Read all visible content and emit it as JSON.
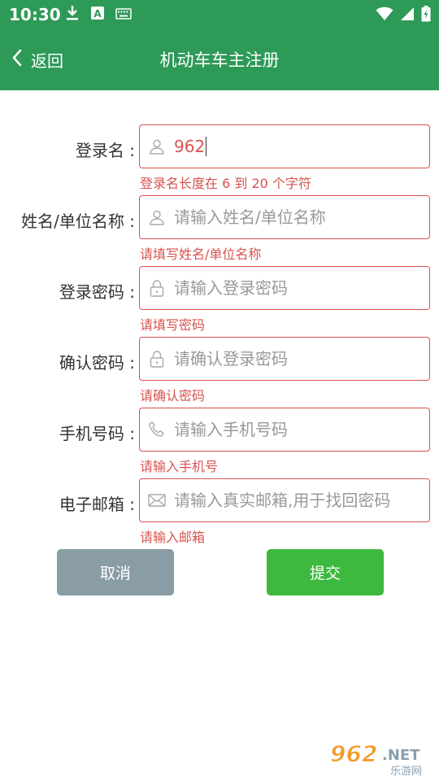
{
  "status": {
    "time": "10:30"
  },
  "header": {
    "back_label": "返回",
    "title": "机动车车主注册"
  },
  "form": {
    "rows": [
      {
        "label": "登录名 :",
        "value": "962",
        "placeholder": "",
        "error": "登录名长度在 6 到 20 个字符",
        "icon": "user-icon"
      },
      {
        "label": "姓名/单位名称 :",
        "value": "",
        "placeholder": "请输入姓名/单位名称",
        "error": "请填写姓名/单位名称",
        "icon": "user-icon"
      },
      {
        "label": "登录密码 :",
        "value": "",
        "placeholder": "请输入登录密码",
        "error": "请填写密码",
        "icon": "lock-icon"
      },
      {
        "label": "确认密码 :",
        "value": "",
        "placeholder": "请确认登录密码",
        "error": "请确认密码",
        "icon": "lock-icon"
      },
      {
        "label": "手机号码 :",
        "value": "",
        "placeholder": "请输入手机号码",
        "error": "请输入手机号",
        "icon": "phone-icon"
      },
      {
        "label": "电子邮箱 :",
        "value": "",
        "placeholder": "请输入真实邮箱,用于找回密码",
        "error": "请输入邮箱",
        "icon": "mail-icon"
      }
    ]
  },
  "actions": {
    "cancel_label": "取消",
    "submit_label": "提交"
  },
  "watermark": {
    "brand": "962.NET",
    "sub": "乐游网"
  },
  "colors": {
    "primary": "#2d9a57",
    "error": "#d9534f",
    "cancel": "#8a9ca6",
    "submit": "#3cb93e"
  }
}
